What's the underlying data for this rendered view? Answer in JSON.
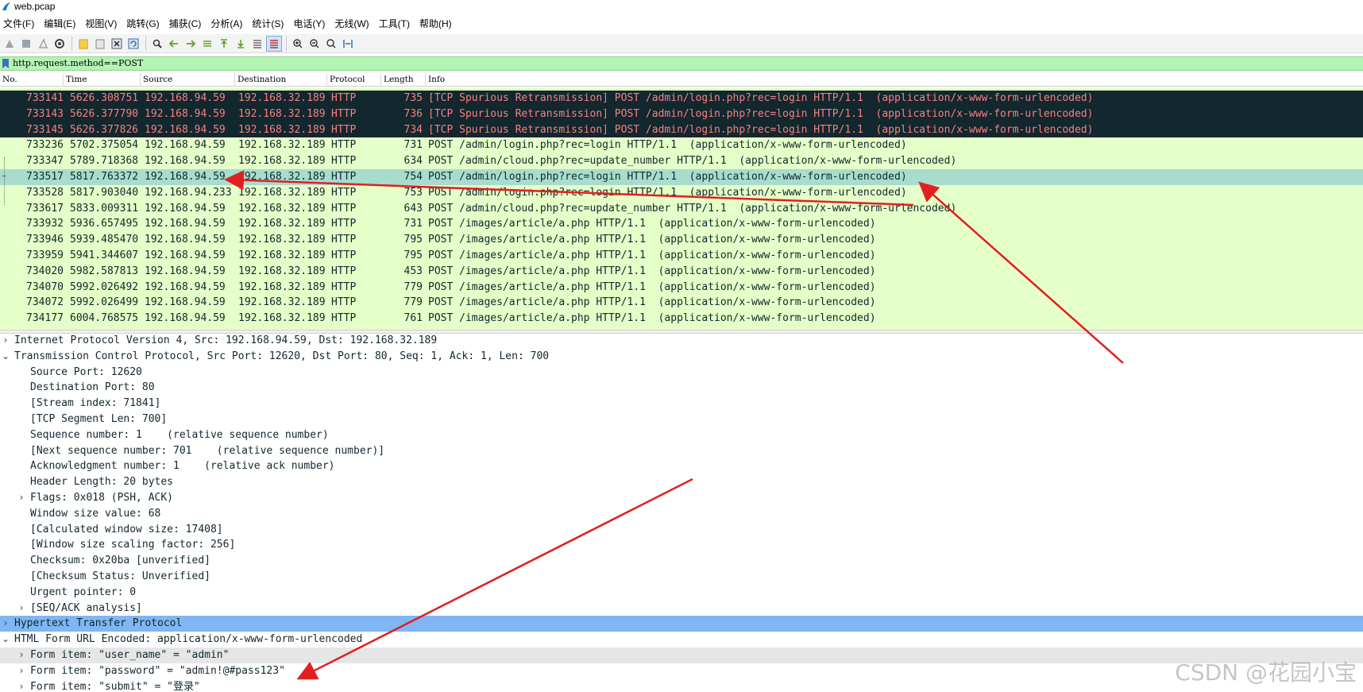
{
  "window": {
    "title": "web.pcap"
  },
  "menu": [
    {
      "label": "文件(F)"
    },
    {
      "label": "编辑(E)"
    },
    {
      "label": "视图(V)"
    },
    {
      "label": "跳转(G)"
    },
    {
      "label": "捕获(C)"
    },
    {
      "label": "分析(A)"
    },
    {
      "label": "统计(S)"
    },
    {
      "label": "电话(Y)"
    },
    {
      "label": "无线(W)"
    },
    {
      "label": "工具(T)"
    },
    {
      "label": "帮助(H)"
    }
  ],
  "filter": {
    "value": "http.request.method==POST"
  },
  "columns": {
    "no": "No.",
    "time": "Time",
    "source": "Source",
    "destination": "Destination",
    "protocol": "Protocol",
    "length": "Length",
    "info": "Info"
  },
  "packets": [
    {
      "no": "733141",
      "time": "5626.308751",
      "src": "192.168.94.59",
      "dst": "192.168.32.189",
      "proto": "HTTP",
      "len": "735",
      "info": "[TCP Spurious Retransmission] POST /admin/login.php?rec=login HTTP/1.1  (application/x-www-form-urlencoded)",
      "style": "dark"
    },
    {
      "no": "733143",
      "time": "5626.377790",
      "src": "192.168.94.59",
      "dst": "192.168.32.189",
      "proto": "HTTP",
      "len": "736",
      "info": "[TCP Spurious Retransmission] POST /admin/login.php?rec=login HTTP/1.1  (application/x-www-form-urlencoded)",
      "style": "dark"
    },
    {
      "no": "733145",
      "time": "5626.377826",
      "src": "192.168.94.59",
      "dst": "192.168.32.189",
      "proto": "HTTP",
      "len": "734",
      "info": "[TCP Spurious Retransmission] POST /admin/login.php?rec=login HTTP/1.1  (application/x-www-form-urlencoded)",
      "style": "dark"
    },
    {
      "no": "733236",
      "time": "5702.375054",
      "src": "192.168.94.59",
      "dst": "192.168.32.189",
      "proto": "HTTP",
      "len": "731",
      "info": "POST /admin/login.php?rec=login HTTP/1.1  (application/x-www-form-urlencoded)",
      "style": "light"
    },
    {
      "no": "733347",
      "time": "5789.718368",
      "src": "192.168.94.59",
      "dst": "192.168.32.189",
      "proto": "HTTP",
      "len": "634",
      "info": "POST /admin/cloud.php?rec=update_number HTTP/1.1  (application/x-www-form-urlencoded)",
      "style": "light"
    },
    {
      "no": "733517",
      "time": "5817.763372",
      "src": "192.168.94.59",
      "dst": "192.168.32.189",
      "proto": "HTTP",
      "len": "754",
      "info": "POST /admin/login.php?rec=login HTTP/1.1  (application/x-www-form-urlencoded)",
      "style": "selected"
    },
    {
      "no": "733528",
      "time": "5817.903040",
      "src": "192.168.94.233",
      "dst": "192.168.32.189",
      "proto": "HTTP",
      "len": "753",
      "info": "POST /admin/login.php?rec=login HTTP/1.1  (application/x-www-form-urlencoded)",
      "style": "light"
    },
    {
      "no": "733617",
      "time": "5833.009311",
      "src": "192.168.94.59",
      "dst": "192.168.32.189",
      "proto": "HTTP",
      "len": "643",
      "info": "POST /admin/cloud.php?rec=update_number HTTP/1.1  (application/x-www-form-urlencoded)",
      "style": "light"
    },
    {
      "no": "733932",
      "time": "5936.657495",
      "src": "192.168.94.59",
      "dst": "192.168.32.189",
      "proto": "HTTP",
      "len": "731",
      "info": "POST /images/article/a.php HTTP/1.1  (application/x-www-form-urlencoded)",
      "style": "light"
    },
    {
      "no": "733946",
      "time": "5939.485470",
      "src": "192.168.94.59",
      "dst": "192.168.32.189",
      "proto": "HTTP",
      "len": "795",
      "info": "POST /images/article/a.php HTTP/1.1  (application/x-www-form-urlencoded)",
      "style": "light"
    },
    {
      "no": "733959",
      "time": "5941.344607",
      "src": "192.168.94.59",
      "dst": "192.168.32.189",
      "proto": "HTTP",
      "len": "795",
      "info": "POST /images/article/a.php HTTP/1.1  (application/x-www-form-urlencoded)",
      "style": "light"
    },
    {
      "no": "734020",
      "time": "5982.587813",
      "src": "192.168.94.59",
      "dst": "192.168.32.189",
      "proto": "HTTP",
      "len": "453",
      "info": "POST /images/article/a.php HTTP/1.1  (application/x-www-form-urlencoded)",
      "style": "light"
    },
    {
      "no": "734070",
      "time": "5992.026492",
      "src": "192.168.94.59",
      "dst": "192.168.32.189",
      "proto": "HTTP",
      "len": "779",
      "info": "POST /images/article/a.php HTTP/1.1  (application/x-www-form-urlencoded)",
      "style": "light"
    },
    {
      "no": "734072",
      "time": "5992.026499",
      "src": "192.168.94.59",
      "dst": "192.168.32.189",
      "proto": "HTTP",
      "len": "779",
      "info": "POST /images/article/a.php HTTP/1.1  (application/x-www-form-urlencoded)",
      "style": "light"
    },
    {
      "no": "734177",
      "time": "6004.768575",
      "src": "192.168.94.59",
      "dst": "192.168.32.189",
      "proto": "HTTP",
      "len": "761",
      "info": "POST /images/article/a.php HTTP/1.1  (application/x-www-form-urlencoded)",
      "style": "light"
    }
  ],
  "details": [
    {
      "text": "Internet Protocol Version 4, Src: 192.168.94.59, Dst: 192.168.32.189",
      "level": 0,
      "chevron": "right",
      "style": ""
    },
    {
      "text": "Transmission Control Protocol, Src Port: 12620, Dst Port: 80, Seq: 1, Ack: 1, Len: 700",
      "level": 0,
      "chevron": "down",
      "style": ""
    },
    {
      "text": "Source Port: 12620",
      "level": 1,
      "chevron": "",
      "style": ""
    },
    {
      "text": "Destination Port: 80",
      "level": 1,
      "chevron": "",
      "style": ""
    },
    {
      "text": "[Stream index: 71841]",
      "level": 1,
      "chevron": "",
      "style": ""
    },
    {
      "text": "[TCP Segment Len: 700]",
      "level": 1,
      "chevron": "",
      "style": ""
    },
    {
      "text": "Sequence number: 1    (relative sequence number)",
      "level": 1,
      "chevron": "",
      "style": ""
    },
    {
      "text": "[Next sequence number: 701    (relative sequence number)]",
      "level": 1,
      "chevron": "",
      "style": ""
    },
    {
      "text": "Acknowledgment number: 1    (relative ack number)",
      "level": 1,
      "chevron": "",
      "style": ""
    },
    {
      "text": "Header Length: 20 bytes",
      "level": 1,
      "chevron": "",
      "style": ""
    },
    {
      "text": "Flags: 0x018 (PSH, ACK)",
      "level": 1,
      "chevron": "right",
      "style": ""
    },
    {
      "text": "Window size value: 68",
      "level": 1,
      "chevron": "",
      "style": ""
    },
    {
      "text": "[Calculated window size: 17408]",
      "level": 1,
      "chevron": "",
      "style": ""
    },
    {
      "text": "[Window size scaling factor: 256]",
      "level": 1,
      "chevron": "",
      "style": ""
    },
    {
      "text": "Checksum: 0x20ba [unverified]",
      "level": 1,
      "chevron": "",
      "style": ""
    },
    {
      "text": "[Checksum Status: Unverified]",
      "level": 1,
      "chevron": "",
      "style": ""
    },
    {
      "text": "Urgent pointer: 0",
      "level": 1,
      "chevron": "",
      "style": ""
    },
    {
      "text": "[SEQ/ACK analysis]",
      "level": 1,
      "chevron": "right",
      "style": ""
    },
    {
      "text": "Hypertext Transfer Protocol",
      "level": 0,
      "chevron": "right",
      "style": "hl"
    },
    {
      "text": "HTML Form URL Encoded: application/x-www-form-urlencoded",
      "level": 0,
      "chevron": "down",
      "style": ""
    },
    {
      "text": "Form item: \"user_name\" = \"admin\"",
      "level": 1,
      "chevron": "right",
      "style": "gray"
    },
    {
      "text": "Form item: \"password\" = \"admin!@#pass123\"",
      "level": 1,
      "chevron": "right",
      "style": ""
    },
    {
      "text": "Form item: \"submit\" = \"登录\"",
      "level": 1,
      "chevron": "right",
      "style": ""
    }
  ],
  "watermark": "CSDN @花园小宝",
  "colors": {
    "dark_row_bg": "#12272e",
    "dark_row_fg": "#f78080",
    "light_row_bg": "#e4ffc7",
    "selected_row_bg": "#a8dccd",
    "filter_bg": "#b3f4b3",
    "highlight_bg": "#7fb6f3",
    "arrow": "#e02020"
  }
}
